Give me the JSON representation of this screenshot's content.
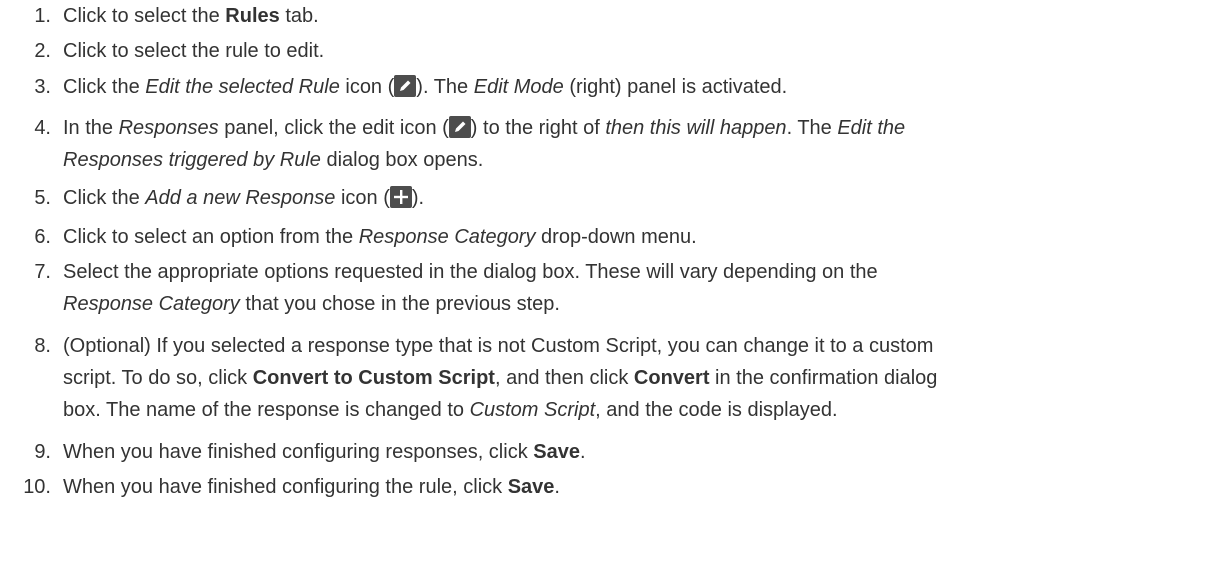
{
  "steps": [
    {
      "num": "1.",
      "parts": [
        "Click to select the ",
        "Rules",
        " tab."
      ]
    },
    {
      "num": "2.",
      "parts": [
        "Click to select the rule to edit."
      ]
    },
    {
      "num": "3.",
      "parts": [
        "Click the ",
        "Edit the selected Rule",
        " icon (",
        ")",
        ". The ",
        "Edit Mode",
        " (right) panel is activated."
      ]
    },
    {
      "num": "4.",
      "parts": [
        "In the ",
        "Responses",
        " panel, click the edit icon (",
        ")",
        " to the right of ",
        "then this will happen",
        ". The ",
        "Edit the",
        "Responses triggered by Rule",
        " dialog box opens."
      ]
    },
    {
      "num": "5.",
      "parts": [
        "Click the ",
        "Add a new Response",
        " icon (",
        ")."
      ]
    },
    {
      "num": "6.",
      "parts": [
        "Click to select an option from the ",
        "Response Category",
        " drop-down menu."
      ]
    },
    {
      "num": "7.",
      "parts": [
        "Select the appropriate options requested in the dialog box. These will vary depending on the",
        "Response Category",
        " that you chose in the previous step."
      ]
    },
    {
      "num": "8.",
      "parts": [
        "(Optional) If you selected a response type that is not Custom Script, you can change it to a custom",
        "script. To do so, click ",
        "Convert to Custom Script",
        ", and then click ",
        "Convert",
        " in the confirmation dialog",
        "box. The name of the response is changed to ",
        "Custom Script",
        ", and the code is displayed."
      ]
    },
    {
      "num": "9.",
      "parts": [
        "When you have finished configuring responses, click ",
        "Save",
        "."
      ]
    },
    {
      "num": "10.",
      "parts": [
        "When you have finished configuring the rule, click ",
        "Save",
        "."
      ]
    }
  ],
  "icons": {
    "edit": "pencil-icon",
    "add": "plus-icon",
    "icon_bg": "#4d4d4d",
    "icon_fg": "#ffffff"
  },
  "text_color": "#333333"
}
